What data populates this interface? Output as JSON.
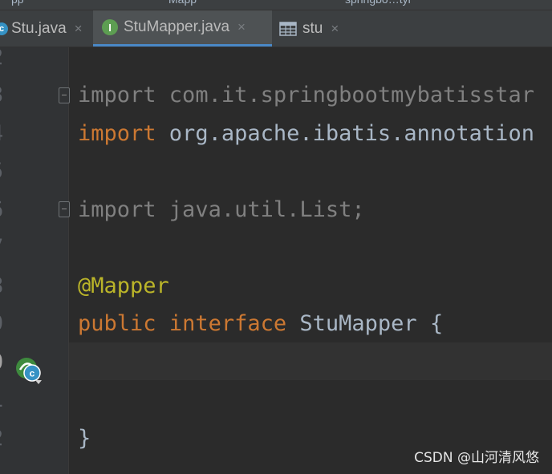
{
  "breadcrumbs": [
    "pp",
    "Mapp",
    "springbo…tyl"
  ],
  "tabs": [
    {
      "label": "Stu.java",
      "icon": "class-icon",
      "active": false
    },
    {
      "label": "StuMapper.java",
      "icon": "interface-icon",
      "active": true
    },
    {
      "label": "stu",
      "icon": "table-icon",
      "active": false
    }
  ],
  "tab_icon_letters": {
    "interface": "I",
    "class": "c"
  },
  "close_glyph": "×",
  "line_numbers": [
    "2",
    "3",
    "4",
    "5",
    "6",
    "7",
    "8",
    "9",
    "0",
    "1",
    "2"
  ],
  "code": {
    "line3": {
      "kw": "import",
      "rest": " com.it.springbootmybatisstar"
    },
    "line4": {
      "kw": "import",
      "rest": " org.apache.ibatis.annotation"
    },
    "line6": {
      "kw": "import",
      "rest": " java.util.List;"
    },
    "line8": {
      "ann": "@Mapper"
    },
    "line9": {
      "kw1": "public",
      "kw2": "interface",
      "name": "StuMapper",
      "brace": "{"
    },
    "line12": {
      "brace": "}"
    }
  },
  "watermark": "CSDN @山河清风悠",
  "colors": {
    "keyword": "#cc7832",
    "annotation": "#bbb529",
    "text": "#a9b7c6",
    "background": "#2b2b2b",
    "tab_active_underline": "#4a88c7"
  }
}
